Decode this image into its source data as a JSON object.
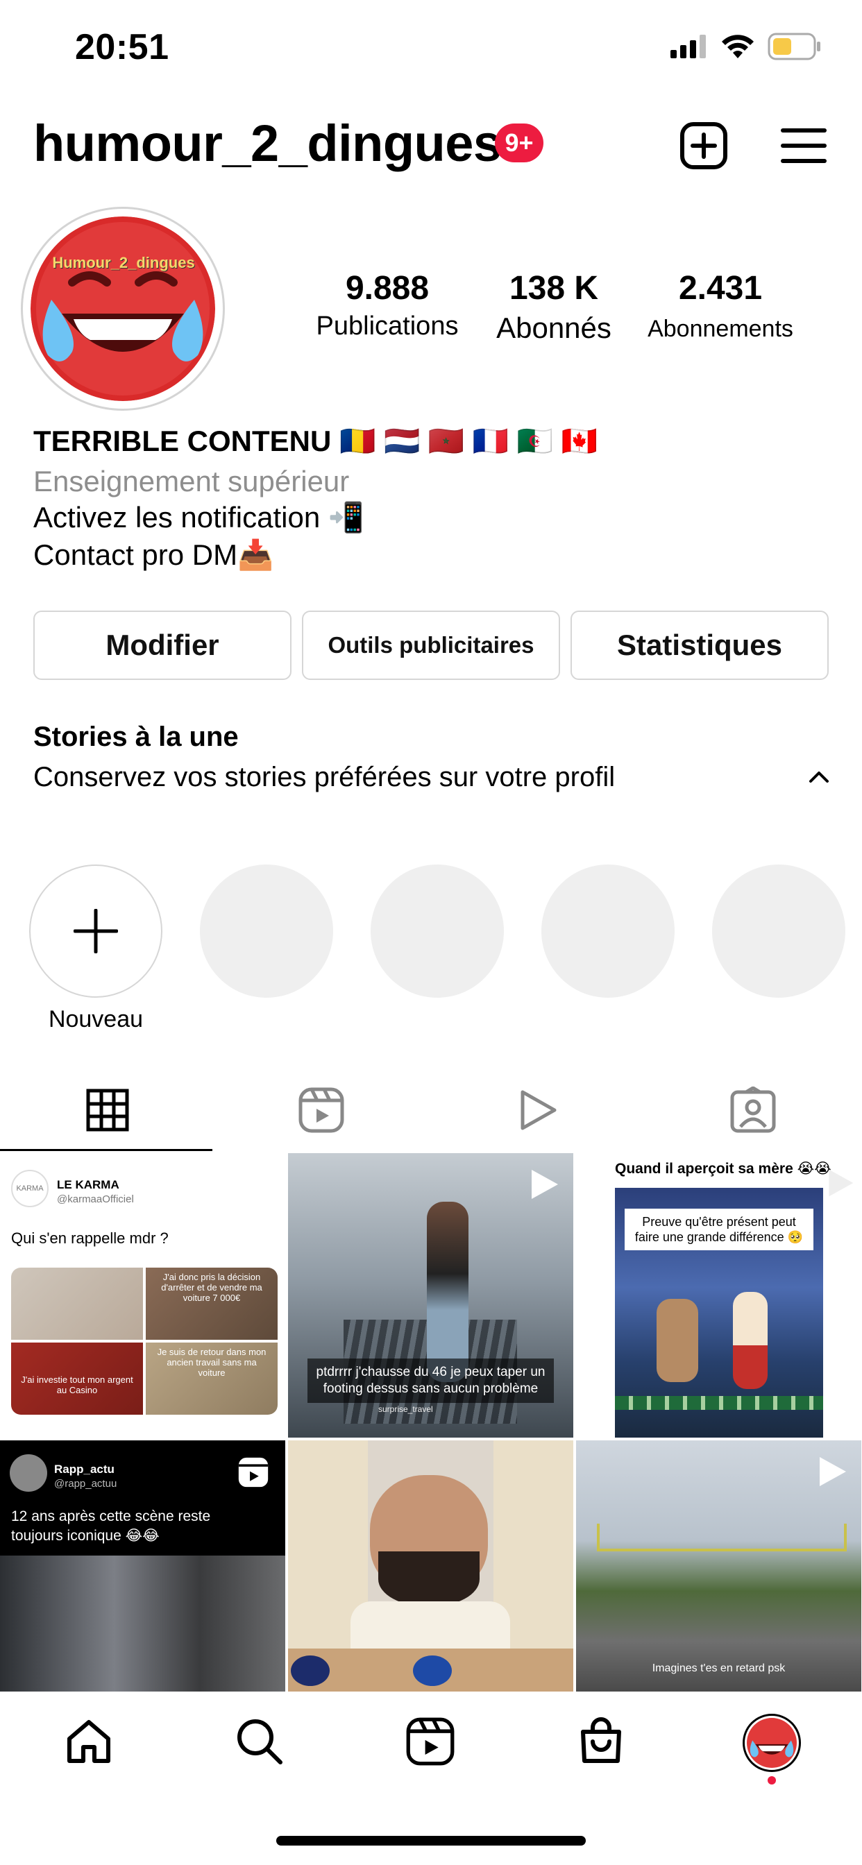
{
  "status_bar": {
    "time": "20:51"
  },
  "header": {
    "username": "humour_2_dingues",
    "notification_badge": "9+",
    "badge_color": "#ed1c40",
    "create_icon": "plus-square-icon",
    "menu_icon": "hamburger-menu-icon"
  },
  "profile": {
    "avatar_text": "Humour_2_dingues",
    "stats": [
      {
        "value": "9.888",
        "label": "Publications"
      },
      {
        "value": "138 K",
        "label": "Abonnés"
      },
      {
        "value": "2.431",
        "label": "Abonnements"
      }
    ],
    "bio": {
      "name_line": "TERRIBLE CONTENU 🇷🇴 🇳🇱 🇲🇦 🇫🇷 🇩🇿 🇨🇦",
      "category": "Enseignement supérieur",
      "line1": "Activez les notification 📲",
      "line2": "Contact pro DM📥"
    },
    "buttons": {
      "edit": "Modifier",
      "ads": "Outils publicitaires",
      "stats": "Statistiques"
    }
  },
  "highlights": {
    "title": "Stories à la une",
    "subtitle": "Conservez vos stories préférées sur votre profil",
    "new_label": "Nouveau"
  },
  "tabs": [
    "grid-icon",
    "reels-icon",
    "play-icon",
    "tagged-icon"
  ],
  "grid": {
    "tile1": {
      "account": "LE KARMA",
      "handle": "@karmaaOfficiel",
      "caption": "Qui s'en rappelle mdr ?",
      "cap_a": "J'ai donc pris la décision d'arrêter et de vendre ma voiture 7 000€",
      "cap_b": "J'ai investie tout mon argent au Casino",
      "cap_c": "Je suis de retour dans mon ancien travail sans ma voiture"
    },
    "tile2": {
      "caption": "ptdrrrr j'chausse du 46 je peux taper un footing dessus sans aucun problème",
      "sub": "surprise_travel"
    },
    "tile3": {
      "top_caption": "Quand il aperçoit sa mère 😭😭",
      "box_caption": "Preuve qu'être présent peut faire une grande différence 🥺"
    },
    "tile4": {
      "account": "Rapp_actu",
      "handle": "@rapp_actuu",
      "caption": "12 ans après cette scène reste toujours iconique 😂😂"
    },
    "tile6": {
      "caption": "Imagines t'es en retard psk"
    }
  }
}
